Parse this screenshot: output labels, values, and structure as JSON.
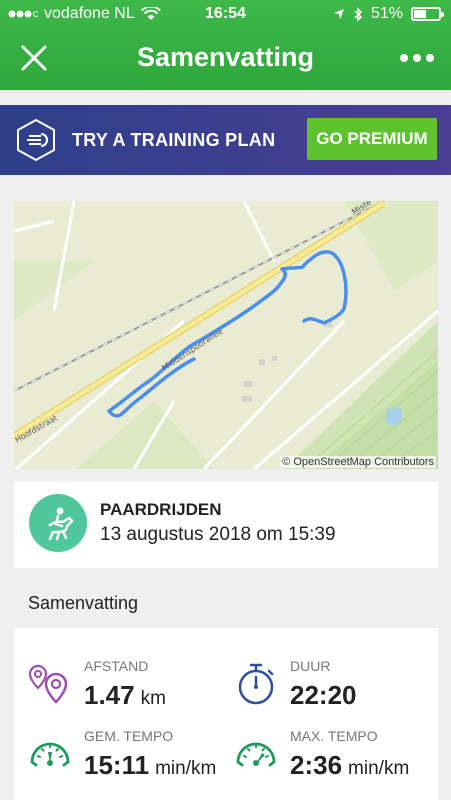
{
  "status_bar": {
    "carrier": "vodafone NL",
    "time": "16:54",
    "battery": "51%",
    "battery_level": 0.51
  },
  "nav": {
    "title": "Samenvatting",
    "close_icon": "close-icon",
    "more_icon": "more-icon"
  },
  "banner": {
    "text": "TRY A TRAINING PLAN",
    "button": "GO PREMIUM"
  },
  "map": {
    "attribution": "© OpenStreetMap Contributors",
    "street_labels": [
      "Hoofdstraat",
      "Middenspoorallee",
      "Miste"
    ]
  },
  "activity": {
    "type": "PAARDRIJDEN",
    "datetime": "13 augustus 2018 om 15:39",
    "icon": "horse-riding-icon"
  },
  "summary": {
    "title": "Samenvatting",
    "stats": [
      {
        "label": "AFSTAND",
        "value": "1.47",
        "unit": "km",
        "icon": "distance-icon"
      },
      {
        "label": "DUUR",
        "value": "22:20",
        "unit": "",
        "icon": "stopwatch-icon"
      },
      {
        "label": "GEM. TEMPO",
        "value": "15:11",
        "unit": "min/km",
        "icon": "speedometer-icon"
      },
      {
        "label": "MAX. TEMPO",
        "value": "2:36",
        "unit": "min/km",
        "icon": "speedometer-icon"
      }
    ]
  },
  "colors": {
    "brand_green": "#3fb84a",
    "premium_green": "#5ec22f",
    "banner_blue": "#2e3f8c",
    "route_blue": "#4a8ef2",
    "activity_teal": "#4fc79a"
  }
}
